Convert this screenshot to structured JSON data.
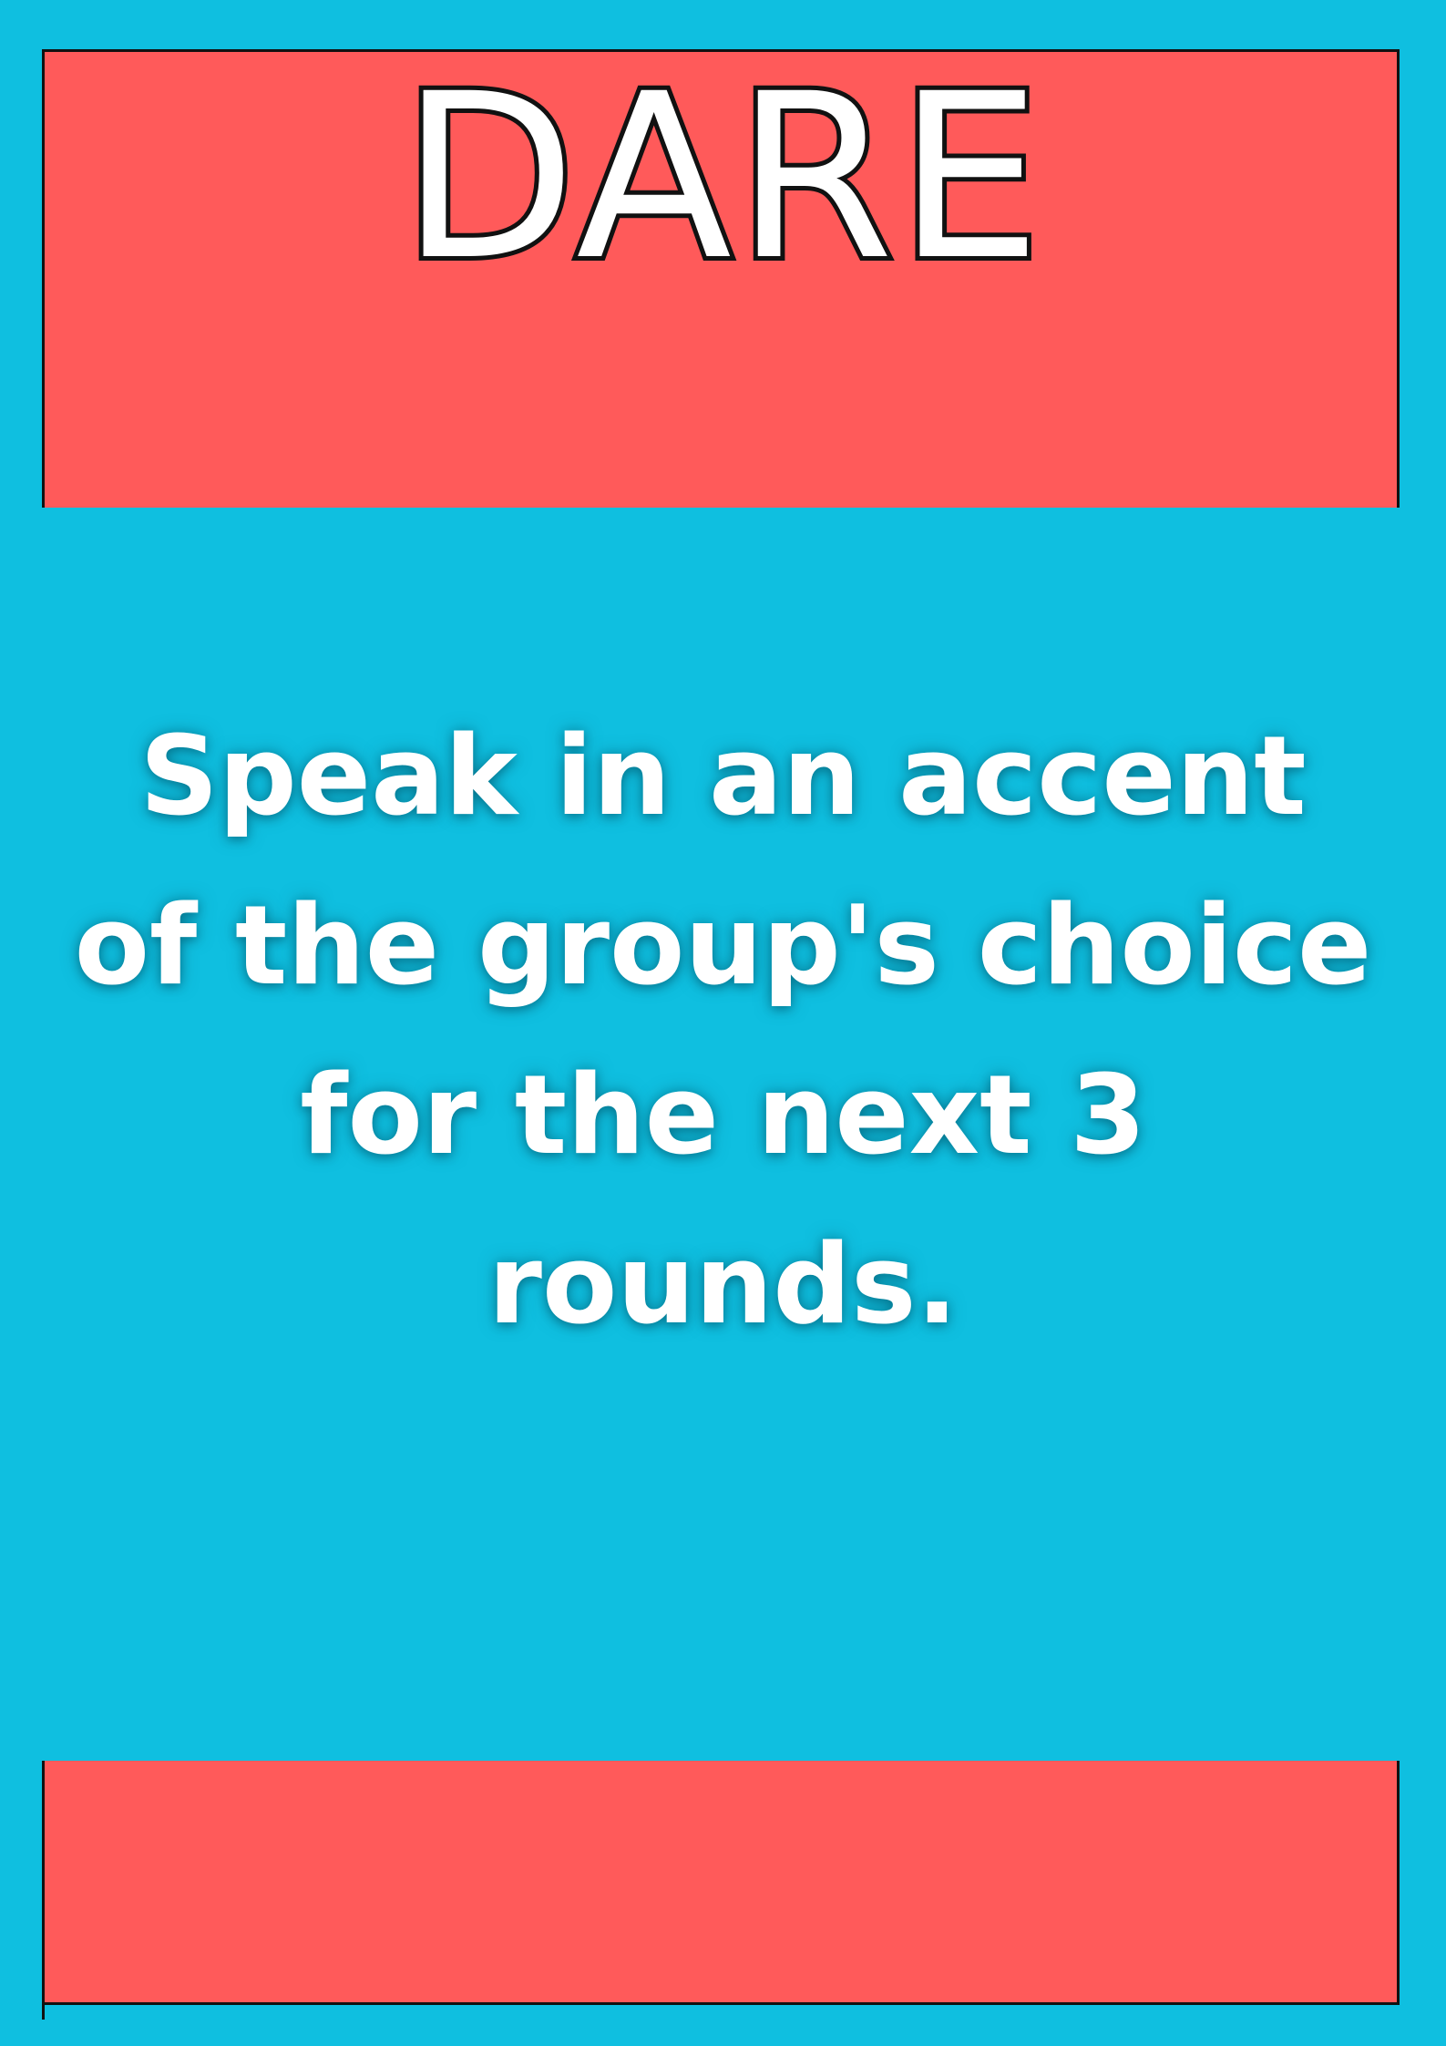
{
  "card": {
    "title": "DARE",
    "prompt_lines": [
      "Speak in an accent",
      "of the group's choice",
      "for the next 3",
      "rounds."
    ]
  },
  "colors": {
    "background": "#0fbfe0",
    "band": "#ff5a5a",
    "border": "#111111",
    "text": "#ffffff"
  }
}
